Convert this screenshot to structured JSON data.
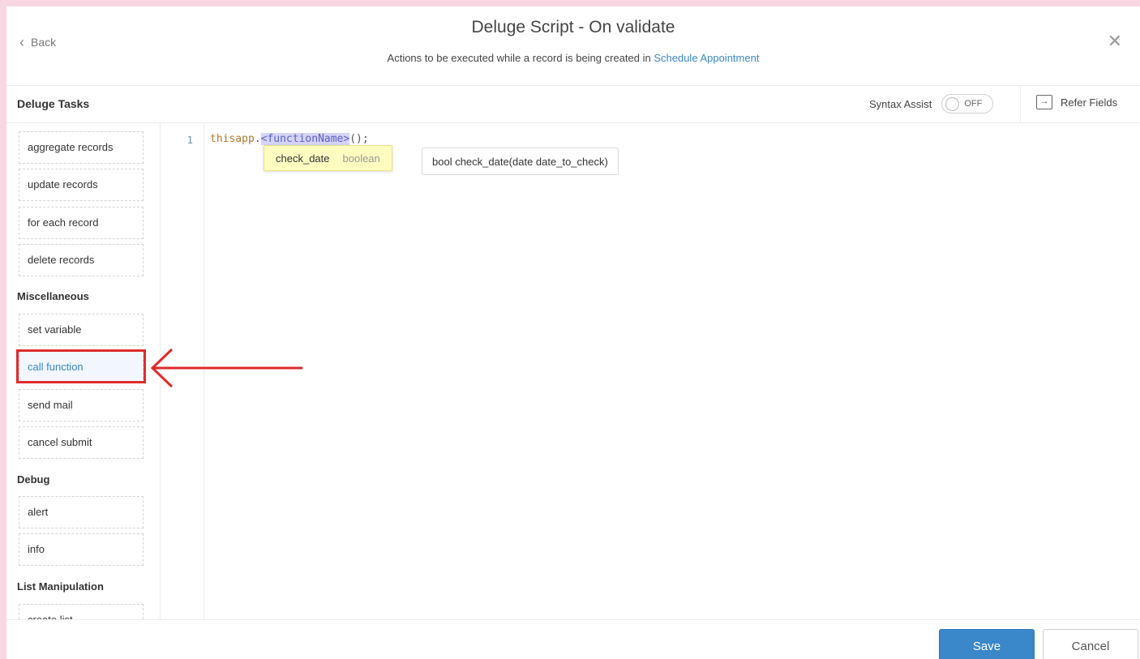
{
  "header": {
    "back_label": "Back",
    "title": "Deluge Script - On validate",
    "subtitle_prefix": "Actions to be executed while a record is being created in ",
    "subtitle_link": "Schedule Appointment"
  },
  "toolbar": {
    "tasks_title": "Deluge Tasks",
    "syntax_assist_label": "Syntax Assist",
    "syntax_assist_state": "OFF",
    "refer_fields_label": "Refer Fields"
  },
  "sidebar": {
    "record_tasks": [
      "aggregate records",
      "update records",
      "for each record",
      "delete records"
    ],
    "misc_title": "Miscellaneous",
    "misc_tasks": [
      "set variable",
      "call function",
      "send mail",
      "cancel submit"
    ],
    "debug_title": "Debug",
    "debug_tasks": [
      "alert",
      "info"
    ],
    "list_title": "List Manipulation",
    "list_tasks": [
      "create list"
    ],
    "active_task": "call function"
  },
  "editor": {
    "line_number": "1",
    "code_object": "thisapp",
    "code_dot": ".",
    "code_placeholder": "<functionName>",
    "code_suffix": "();",
    "suggestion_name": "check_date",
    "suggestion_type": "boolean",
    "signature": "bool check_date(date date_to_check)"
  },
  "footer": {
    "save_label": "Save",
    "cancel_label": "Cancel"
  },
  "colors": {
    "accent": "#3a87c9",
    "annotation": "#e02b2b",
    "background": "#f8d7e3"
  }
}
